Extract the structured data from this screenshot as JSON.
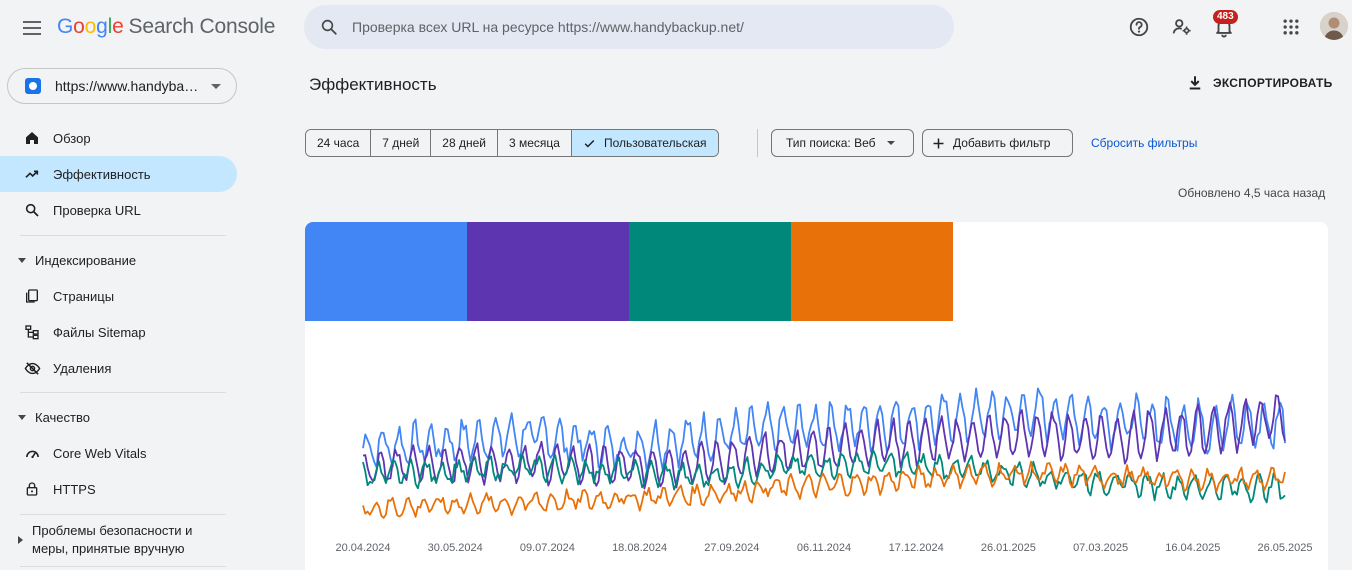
{
  "header": {
    "brand": {
      "google_letters": [
        "G",
        "o",
        "o",
        "g",
        "l",
        "e"
      ],
      "product": "Search Console"
    },
    "search_placeholder": "Проверка всех URL на ресурсе https://www.handybackup.net/",
    "notifications_count": "483",
    "icons": [
      "menu-icon",
      "search-icon",
      "help-icon",
      "manage-users-icon",
      "notifications-icon",
      "apps-grid-icon",
      "avatar"
    ]
  },
  "sidebar": {
    "property_url": "https://www.handybackup.net/",
    "items_top": [
      {
        "label": "Обзор",
        "icon": "home-icon"
      },
      {
        "label": "Эффективность",
        "icon": "trending-up-icon",
        "active": true
      },
      {
        "label": "Проверка URL",
        "icon": "search-icon"
      }
    ],
    "indexing": {
      "title": "Индексирование",
      "items": [
        {
          "label": "Страницы",
          "icon": "pages-icon"
        },
        {
          "label": "Файлы Sitemap",
          "icon": "sitemap-icon"
        },
        {
          "label": "Удаления",
          "icon": "visibility-off-icon"
        }
      ]
    },
    "quality": {
      "title": "Качество",
      "items": [
        {
          "label": "Core Web Vitals",
          "icon": "speed-icon"
        },
        {
          "label": "HTTPS",
          "icon": "lock-icon"
        }
      ]
    },
    "security": {
      "title_line1": "Проблемы безопасности и",
      "title_line2": "меры, принятые вручную"
    }
  },
  "main": {
    "title": "Эффективность",
    "export_label": "ЭКСПОРТИРОВАТЬ",
    "date_ranges": [
      "24 часа",
      "7 дней",
      "28 дней",
      "3 месяца",
      "Пользовательская"
    ],
    "selected_range": "Пользовательская",
    "search_type_chip": "Тип поиска: Веб",
    "add_filter_label": "Добавить фильтр",
    "reset_filters_label": "Сбросить фильтры",
    "updated_text": "Обновлено 4,5 часа назад",
    "metric_colors": [
      "#4285f4",
      "#5e35b1",
      "#00897b",
      "#e8710a"
    ]
  },
  "chart_data": {
    "type": "line",
    "x_tick_labels": [
      "20.04.2024",
      "30.05.2024",
      "09.07.2024",
      "18.08.2024",
      "27.09.2024",
      "06.11.2024",
      "17.12.2024",
      "26.01.2025",
      "07.03.2025",
      "16.04.2025",
      "26.05.2025"
    ],
    "y_axis": "hidden (each series normalized to its own scale, 0–100)",
    "grid": false,
    "series": [
      {
        "color": "#4285f4",
        "weekly_oscillation": true,
        "trend": [
          40,
          43,
          47,
          40,
          45,
          50,
          52,
          55,
          58,
          54,
          52,
          52
        ]
      },
      {
        "color": "#5e35b1",
        "weekly_oscillation": true,
        "trend": [
          30,
          32,
          33,
          30,
          32,
          37,
          42,
          44,
          47,
          45,
          49,
          56
        ]
      },
      {
        "color": "#00897b",
        "weekly_oscillation": true,
        "trend": [
          26,
          28,
          30,
          28,
          25,
          30,
          32,
          30,
          26,
          22,
          20,
          20
        ]
      },
      {
        "color": "#e8710a",
        "weekly_oscillation": true,
        "trend": [
          9,
          11,
          12,
          14,
          16,
          20,
          22,
          26,
          27,
          25,
          24,
          24
        ]
      }
    ]
  }
}
